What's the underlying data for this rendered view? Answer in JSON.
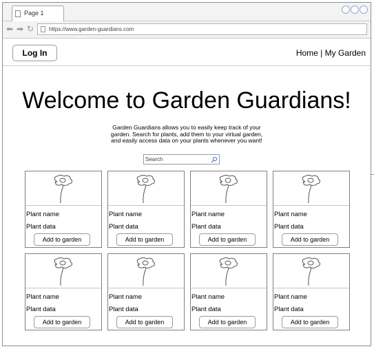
{
  "browser": {
    "tab_label": "Page 1",
    "url": "https://www.garden-guardians.com"
  },
  "header": {
    "login_label": "Log In",
    "nav": {
      "home": "Home",
      "separator": "|",
      "my_garden": "My Garden"
    }
  },
  "main": {
    "title": "Welcome to Garden Guardians!",
    "intro_lines": [
      "Garden Guardians allows you to easily keep track of your",
      "garden. Search for plants, add them to your virtual garden,",
      "and easily access data on your plants whenever you want!"
    ],
    "search": {
      "placeholder": "Search"
    }
  },
  "plants": [
    {
      "name": "Plant name",
      "data": "Plant data",
      "button": "Add to garden"
    },
    {
      "name": "Plant name",
      "data": "Plant data",
      "button": "Add to garden"
    },
    {
      "name": "Plant name",
      "data": "Plant data",
      "button": "Add to garden"
    },
    {
      "name": "Plant name",
      "data": "Plant data",
      "button": "Add to garden"
    },
    {
      "name": "Plant name",
      "data": "Plant data",
      "button": "Add to garden"
    },
    {
      "name": "Plant name",
      "data": "Plant data",
      "button": "Add to garden"
    },
    {
      "name": "Plant name",
      "data": "Plant data",
      "button": "Add to garden"
    },
    {
      "name": "Plant name",
      "data": "Plant data",
      "button": "Add to garden"
    }
  ],
  "icons": {
    "tab": "page-icon",
    "back": "back-arrow-icon",
    "forward": "forward-arrow-icon",
    "reload": "reload-icon",
    "search": "search-icon",
    "plant_image": "flower-icon"
  }
}
